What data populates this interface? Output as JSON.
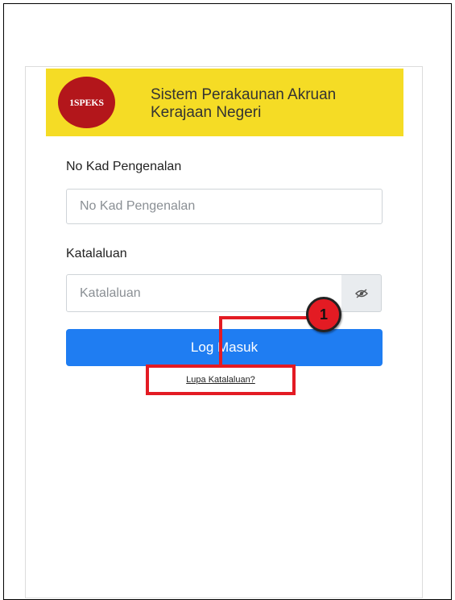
{
  "banner": {
    "logo_text": "1SPEKS",
    "title": "Sistem Perakaunan Akruan Kerajaan Negeri"
  },
  "form": {
    "id_label": "No Kad Pengenalan",
    "id_placeholder": "No Kad Pengenalan",
    "password_label": "Katalaluan",
    "password_placeholder": "Katalaluan",
    "login_label": "Log Masuk",
    "forgot_label": "Lupa Katalaluan?"
  },
  "annotation": {
    "step_number": "1"
  },
  "colors": {
    "banner": "#f5dc25",
    "logo": "#b3161b",
    "primary": "#1f7df2",
    "highlight": "#e31b23"
  },
  "icons": {
    "password_toggle": "eye-icon"
  }
}
